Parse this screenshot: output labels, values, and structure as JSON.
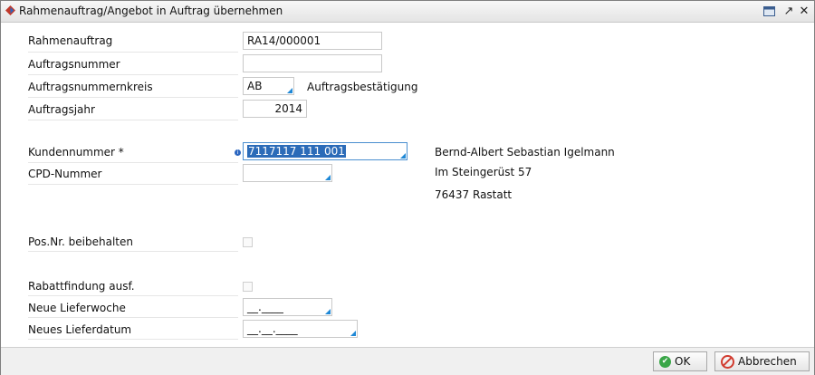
{
  "window": {
    "title": "Rahmenauftrag/Angebot in Auftrag übernehmen",
    "controls": {
      "restore": "▭",
      "maximize": "↗",
      "close": "✕"
    }
  },
  "form": {
    "rahmenauftrag": {
      "label": "Rahmenauftrag",
      "value": "RA14/000001"
    },
    "auftragsnummer": {
      "label": "Auftragsnummer",
      "value": ""
    },
    "auftragsnummernkreis": {
      "label": "Auftragsnummernkreis",
      "value": "AB",
      "description": "Auftragsbestätigung"
    },
    "auftragsjahr": {
      "label": "Auftragsjahr",
      "value": "2014"
    },
    "kundennummer": {
      "label": "Kundennummer *",
      "value": "7117117 111 001",
      "info_icon": "i"
    },
    "cpd_nummer": {
      "label": "CPD-Nummer",
      "value": ""
    },
    "customer": {
      "name": "Bernd-Albert Sebastian Igelmann",
      "street": "Im Steingerüst 57",
      "city": "76437 Rastatt"
    },
    "posnr_beibehalten": {
      "label": "Pos.Nr. beibehalten",
      "checked": false
    },
    "rabattfindung": {
      "label": "Rabattfindung ausf.",
      "checked": false
    },
    "neue_lieferwoche": {
      "label": "Neue Lieferwoche",
      "value": "__.____"
    },
    "neues_lieferdatum": {
      "label": "Neues Lieferdatum",
      "value": "__.__.____"
    }
  },
  "buttons": {
    "ok": "OK",
    "cancel": "Abbrechen"
  },
  "colors": {
    "accent": "#1f88d6",
    "selection": "#2b6bb8",
    "ok_green": "#3aa648",
    "cancel_red": "#d13b2f"
  }
}
